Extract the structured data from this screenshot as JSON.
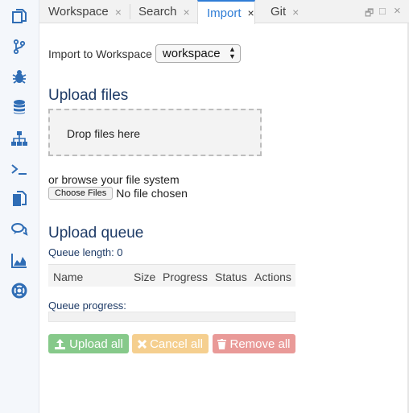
{
  "activity_bar": {
    "icons": [
      "files-icon",
      "git-branch-icon",
      "debug-bug-icon",
      "database-icon",
      "sitemap-icon",
      "terminal-icon",
      "copy-icon",
      "comments-icon",
      "area-chart-icon",
      "lifebuoy-icon"
    ]
  },
  "tabs": [
    {
      "label": "Workspace",
      "close": "×"
    },
    {
      "label": "Search",
      "close": "×"
    },
    {
      "label": "Import",
      "close": "×",
      "active": true
    },
    {
      "label": "Git",
      "close": "×"
    }
  ],
  "window_controls": {
    "restore": "🗗",
    "maximize": "□",
    "close": "×"
  },
  "import": {
    "label": "Import to Workspace",
    "select_value": "workspace",
    "select_arrow_up": "▲",
    "select_arrow_down": "▼"
  },
  "upload": {
    "heading": "Upload files",
    "dropzone_text": "Drop files here",
    "browse_text": "or browse your file system",
    "choose_button": "Choose Files",
    "no_file_text": "No file chosen"
  },
  "queue": {
    "heading": "Upload queue",
    "length_text": "Queue length: 0",
    "columns": [
      "Name",
      "Size",
      "Progress",
      "Status",
      "Actions"
    ],
    "progress_label": "Queue progress:",
    "progress_value": 0
  },
  "buttons": {
    "upload_all": "Upload all",
    "cancel_all": "Cancel all",
    "remove_all": "Remove all"
  },
  "colors": {
    "accent": "#2f7dd6",
    "upload": "#86c98a",
    "cancel": "#f5cf8f",
    "remove": "#e99a98"
  }
}
